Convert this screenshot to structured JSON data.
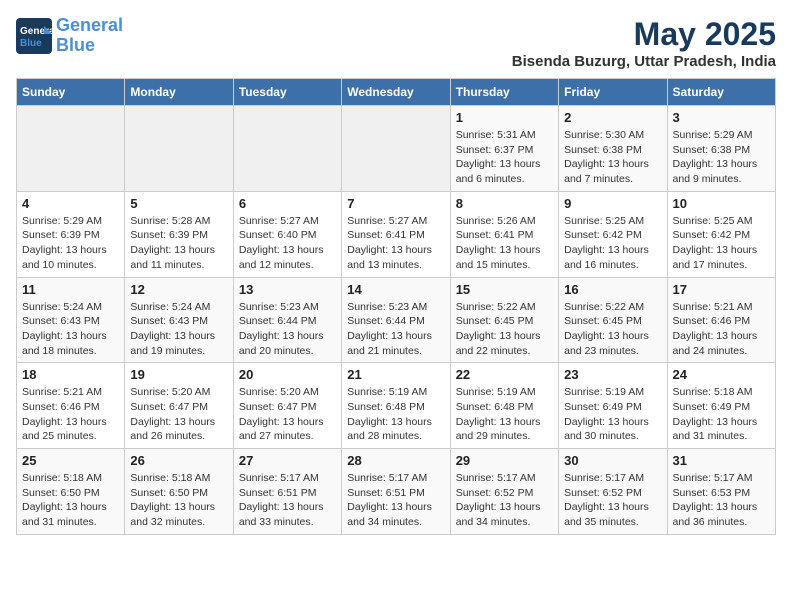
{
  "header": {
    "logo_line1": "General",
    "logo_line2": "Blue",
    "title": "May 2025",
    "subtitle": "Bisenda Buzurg, Uttar Pradesh, India"
  },
  "days_of_week": [
    "Sunday",
    "Monday",
    "Tuesday",
    "Wednesday",
    "Thursday",
    "Friday",
    "Saturday"
  ],
  "weeks": [
    [
      {
        "day": "",
        "info": ""
      },
      {
        "day": "",
        "info": ""
      },
      {
        "day": "",
        "info": ""
      },
      {
        "day": "",
        "info": ""
      },
      {
        "day": "1",
        "info": "Sunrise: 5:31 AM\nSunset: 6:37 PM\nDaylight: 13 hours\nand 6 minutes."
      },
      {
        "day": "2",
        "info": "Sunrise: 5:30 AM\nSunset: 6:38 PM\nDaylight: 13 hours\nand 7 minutes."
      },
      {
        "day": "3",
        "info": "Sunrise: 5:29 AM\nSunset: 6:38 PM\nDaylight: 13 hours\nand 9 minutes."
      }
    ],
    [
      {
        "day": "4",
        "info": "Sunrise: 5:29 AM\nSunset: 6:39 PM\nDaylight: 13 hours\nand 10 minutes."
      },
      {
        "day": "5",
        "info": "Sunrise: 5:28 AM\nSunset: 6:39 PM\nDaylight: 13 hours\nand 11 minutes."
      },
      {
        "day": "6",
        "info": "Sunrise: 5:27 AM\nSunset: 6:40 PM\nDaylight: 13 hours\nand 12 minutes."
      },
      {
        "day": "7",
        "info": "Sunrise: 5:27 AM\nSunset: 6:41 PM\nDaylight: 13 hours\nand 13 minutes."
      },
      {
        "day": "8",
        "info": "Sunrise: 5:26 AM\nSunset: 6:41 PM\nDaylight: 13 hours\nand 15 minutes."
      },
      {
        "day": "9",
        "info": "Sunrise: 5:25 AM\nSunset: 6:42 PM\nDaylight: 13 hours\nand 16 minutes."
      },
      {
        "day": "10",
        "info": "Sunrise: 5:25 AM\nSunset: 6:42 PM\nDaylight: 13 hours\nand 17 minutes."
      }
    ],
    [
      {
        "day": "11",
        "info": "Sunrise: 5:24 AM\nSunset: 6:43 PM\nDaylight: 13 hours\nand 18 minutes."
      },
      {
        "day": "12",
        "info": "Sunrise: 5:24 AM\nSunset: 6:43 PM\nDaylight: 13 hours\nand 19 minutes."
      },
      {
        "day": "13",
        "info": "Sunrise: 5:23 AM\nSunset: 6:44 PM\nDaylight: 13 hours\nand 20 minutes."
      },
      {
        "day": "14",
        "info": "Sunrise: 5:23 AM\nSunset: 6:44 PM\nDaylight: 13 hours\nand 21 minutes."
      },
      {
        "day": "15",
        "info": "Sunrise: 5:22 AM\nSunset: 6:45 PM\nDaylight: 13 hours\nand 22 minutes."
      },
      {
        "day": "16",
        "info": "Sunrise: 5:22 AM\nSunset: 6:45 PM\nDaylight: 13 hours\nand 23 minutes."
      },
      {
        "day": "17",
        "info": "Sunrise: 5:21 AM\nSunset: 6:46 PM\nDaylight: 13 hours\nand 24 minutes."
      }
    ],
    [
      {
        "day": "18",
        "info": "Sunrise: 5:21 AM\nSunset: 6:46 PM\nDaylight: 13 hours\nand 25 minutes."
      },
      {
        "day": "19",
        "info": "Sunrise: 5:20 AM\nSunset: 6:47 PM\nDaylight: 13 hours\nand 26 minutes."
      },
      {
        "day": "20",
        "info": "Sunrise: 5:20 AM\nSunset: 6:47 PM\nDaylight: 13 hours\nand 27 minutes."
      },
      {
        "day": "21",
        "info": "Sunrise: 5:19 AM\nSunset: 6:48 PM\nDaylight: 13 hours\nand 28 minutes."
      },
      {
        "day": "22",
        "info": "Sunrise: 5:19 AM\nSunset: 6:48 PM\nDaylight: 13 hours\nand 29 minutes."
      },
      {
        "day": "23",
        "info": "Sunrise: 5:19 AM\nSunset: 6:49 PM\nDaylight: 13 hours\nand 30 minutes."
      },
      {
        "day": "24",
        "info": "Sunrise: 5:18 AM\nSunset: 6:49 PM\nDaylight: 13 hours\nand 31 minutes."
      }
    ],
    [
      {
        "day": "25",
        "info": "Sunrise: 5:18 AM\nSunset: 6:50 PM\nDaylight: 13 hours\nand 31 minutes."
      },
      {
        "day": "26",
        "info": "Sunrise: 5:18 AM\nSunset: 6:50 PM\nDaylight: 13 hours\nand 32 minutes."
      },
      {
        "day": "27",
        "info": "Sunrise: 5:17 AM\nSunset: 6:51 PM\nDaylight: 13 hours\nand 33 minutes."
      },
      {
        "day": "28",
        "info": "Sunrise: 5:17 AM\nSunset: 6:51 PM\nDaylight: 13 hours\nand 34 minutes."
      },
      {
        "day": "29",
        "info": "Sunrise: 5:17 AM\nSunset: 6:52 PM\nDaylight: 13 hours\nand 34 minutes."
      },
      {
        "day": "30",
        "info": "Sunrise: 5:17 AM\nSunset: 6:52 PM\nDaylight: 13 hours\nand 35 minutes."
      },
      {
        "day": "31",
        "info": "Sunrise: 5:17 AM\nSunset: 6:53 PM\nDaylight: 13 hours\nand 36 minutes."
      }
    ]
  ]
}
